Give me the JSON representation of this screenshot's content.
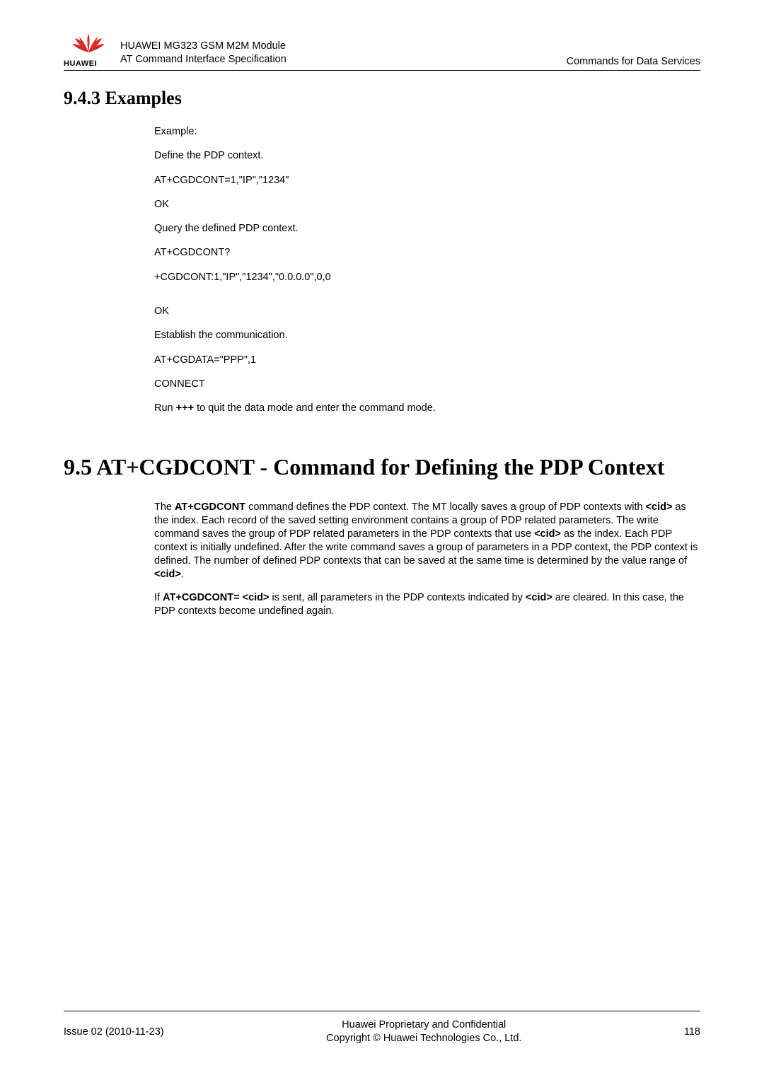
{
  "header": {
    "logo_text": "HUAWEI",
    "title_line1": "HUAWEI MG323 GSM M2M Module",
    "title_line2": "AT Command Interface Specification",
    "right": "Commands for Data Services"
  },
  "section_943": {
    "heading": "9.4.3 Examples",
    "lines": {
      "l1": "Example:",
      "l2": "Define the PDP context.",
      "l3": "AT+CGDCONT=1,\"IP\",\"1234\"",
      "l4": "OK",
      "l5": "Query the defined PDP context.",
      "l6": "AT+CGDCONT?",
      "l7": "+CGDCONT:1,\"IP\",\"1234\",\"0.0.0.0\",0,0",
      "l8": "OK",
      "l9": "Establish the communication.",
      "l10": "AT+CGDATA=\"PPP\",1",
      "l11": "CONNECT",
      "l12_a": "Run ",
      "l12_b": "+++",
      "l12_c": " to quit the data mode and enter the command mode."
    }
  },
  "section_95": {
    "heading": "9.5 AT+CGDCONT - Command for Defining the PDP Context",
    "p1_a": "The ",
    "p1_b": "AT+CGDCONT",
    "p1_c": " command defines the PDP context. The MT locally saves a group of PDP contexts with ",
    "p1_d": "<cid>",
    "p1_e": " as the index. Each record of the saved setting environment contains a group of PDP related parameters. The write command saves the group of PDP related parameters in the PDP contexts that use ",
    "p1_f": "<cid>",
    "p1_g": " as the index. Each PDP context is initially undefined. After the write command saves a group of parameters in a PDP context, the PDP context is defined. The number of defined PDP contexts that can be saved at the same time is determined by the value range of ",
    "p1_h": "<cid>",
    "p1_i": ".",
    "p2_a": "If ",
    "p2_b": "AT+CGDCONT= <cid>",
    "p2_c": " is sent, all parameters in the PDP contexts indicated by ",
    "p2_d": "<cid>",
    "p2_e": " are cleared. In this case, the PDP contexts become undefined again."
  },
  "footer": {
    "left": "Issue 02 (2010-11-23)",
    "center_l1": "Huawei Proprietary and Confidential",
    "center_l2": "Copyright © Huawei Technologies Co., Ltd.",
    "right": "118"
  }
}
